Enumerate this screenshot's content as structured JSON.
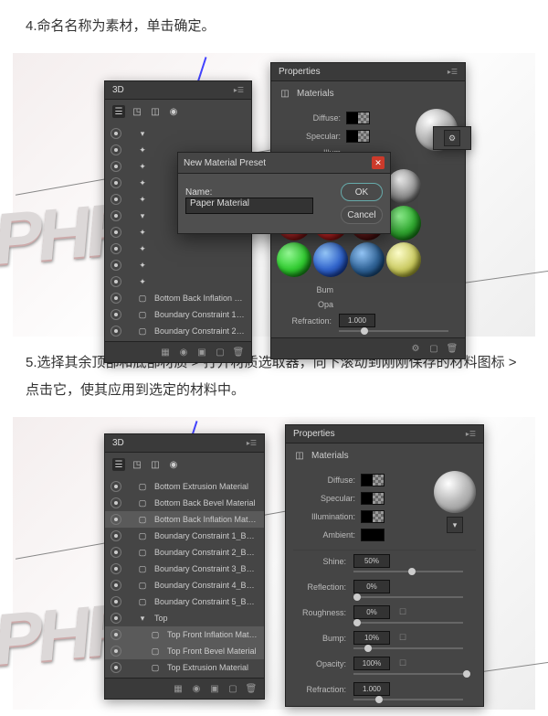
{
  "step4": {
    "num": "4",
    "text": ".命名名称为素材，单击确定。"
  },
  "step5": {
    "num": "5",
    "text": ".选择其余顶部和底部材质 > 打开材质选取器，向下滚动到刚刚保存的材料图标 > 点击它，使其应用到选定的材料中。"
  },
  "fig1": {
    "threeD": {
      "title": "3D",
      "items": [
        {
          "label": "",
          "kind": "group"
        },
        {
          "label": "",
          "kind": "node"
        },
        {
          "label": "",
          "kind": "node"
        },
        {
          "label": "",
          "kind": "node"
        },
        {
          "label": "",
          "kind": "node"
        },
        {
          "label": "",
          "kind": "group"
        },
        {
          "label": "",
          "kind": "node"
        },
        {
          "label": "",
          "kind": "node"
        },
        {
          "label": "",
          "kind": "node"
        },
        {
          "label": "",
          "kind": "node"
        },
        {
          "label": "Bottom Back Inflation Mate...",
          "kind": "mat"
        },
        {
          "label": "Boundary Constraint 1_Bott...",
          "kind": "mat"
        },
        {
          "label": "Boundary Constraint 2_Bott...",
          "kind": "mat"
        }
      ]
    },
    "props": {
      "title": "Properties",
      "section": "Materials",
      "diffuse": "Diffuse:",
      "specular": "Specular:",
      "illum": "Illum",
      "bump": "Bum",
      "opa": "Opa",
      "refraction": "Refraction:",
      "refraction_val": "1.000"
    },
    "dialog": {
      "title": "New Material Preset",
      "name_label": "Name:",
      "name_value": "Paper Material",
      "ok": "OK",
      "cancel": "Cancel"
    }
  },
  "fig2": {
    "threeD": {
      "title": "3D",
      "items": [
        {
          "label": "Bottom Extrusion Material",
          "kind": "mat"
        },
        {
          "label": "Bottom Back Bevel Material",
          "kind": "mat"
        },
        {
          "label": "Bottom Back Inflation Mate...",
          "kind": "mat",
          "sel": true
        },
        {
          "label": "Boundary Constraint 1_Bott...",
          "kind": "mat"
        },
        {
          "label": "Boundary Constraint 2_Bott...",
          "kind": "mat"
        },
        {
          "label": "Boundary Constraint 3_Bott...",
          "kind": "mat"
        },
        {
          "label": "Boundary Constraint 4_Bott...",
          "kind": "mat"
        },
        {
          "label": "Boundary Constraint 5_Bott...",
          "kind": "mat"
        },
        {
          "label": "Top",
          "kind": "group"
        },
        {
          "label": "Top Front Inflation Material",
          "kind": "mat",
          "sel": true,
          "indent": 1
        },
        {
          "label": "Top Front Bevel Material",
          "kind": "mat",
          "sel": true,
          "indent": 1
        },
        {
          "label": "Top Extrusion Material",
          "kind": "mat",
          "indent": 1
        }
      ]
    },
    "props": {
      "title": "Properties",
      "section": "Materials",
      "diffuse": "Diffuse:",
      "specular": "Specular:",
      "illum": "Illumination:",
      "ambient": "Ambient:",
      "sliders": [
        {
          "label": "Shine:",
          "val": "50%",
          "pct": "50%",
          "extra": ""
        },
        {
          "label": "Reflection:",
          "val": "0%",
          "pct": "0%",
          "extra": ""
        },
        {
          "label": "Roughness:",
          "val": "0%",
          "pct": "0%",
          "extra": "☐"
        },
        {
          "label": "Bump:",
          "val": "10%",
          "pct": "10%",
          "extra": "☐"
        },
        {
          "label": "Opacity:",
          "val": "100%",
          "pct": "100%",
          "extra": "☐"
        },
        {
          "label": "Refraction:",
          "val": "1.000",
          "pct": "20%",
          "extra": ""
        }
      ]
    }
  }
}
